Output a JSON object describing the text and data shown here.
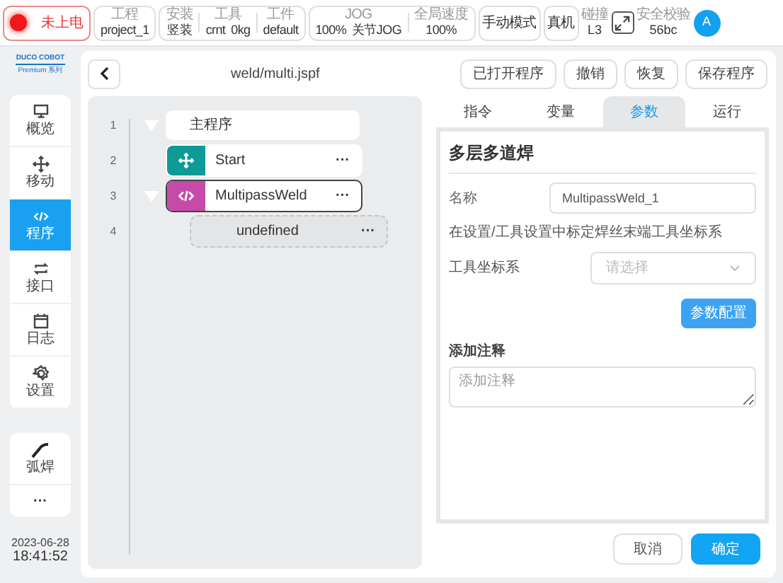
{
  "top_bar": [
    {
      "kind": "power",
      "label": "未上电",
      "on": false
    },
    {
      "kind": "group",
      "fields": [
        {
          "caption": "工程",
          "values": [
            "project_1"
          ]
        }
      ]
    },
    {
      "kind": "group",
      "fields": [
        {
          "caption": "安装",
          "values": [
            "竖装"
          ]
        },
        {
          "caption": "工具",
          "values": [
            "crnt",
            "0kg"
          ]
        },
        {
          "caption": "工件",
          "values": [
            "default"
          ]
        }
      ]
    },
    {
      "kind": "group",
      "fields": [
        {
          "caption": "JOG",
          "values": [
            "100%",
            "关节JOG"
          ]
        },
        {
          "caption": "全局速度",
          "values": [
            "100%"
          ]
        }
      ]
    },
    {
      "kind": "button",
      "label": "手动模式"
    },
    {
      "kind": "button",
      "label": "真机"
    },
    {
      "kind": "info",
      "caption": "碰撞",
      "value": "L3"
    },
    {
      "kind": "expand"
    },
    {
      "kind": "info",
      "caption": "安全校验",
      "value": "56bc"
    },
    {
      "kind": "avatar",
      "label": "A"
    }
  ],
  "logo": {
    "brand": "DUCO COBOT",
    "series": "Premium 系列"
  },
  "sidebar": {
    "items": [
      {
        "label": "概览",
        "selected": false
      },
      {
        "label": "移动",
        "selected": false
      },
      {
        "label": "程序",
        "selected": true
      },
      {
        "label": "接口",
        "selected": false
      },
      {
        "label": "日志",
        "selected": false
      },
      {
        "label": "设置",
        "selected": false
      }
    ],
    "extra": [
      {
        "kind": "tool",
        "label": "弧焊"
      },
      {
        "kind": "more",
        "label": "···"
      }
    ],
    "date": "2023-06-28",
    "time": "18:41:52"
  },
  "header": {
    "title": "weld/multi.jspf",
    "buttons": [
      "已打开程序",
      "撤销",
      "恢复",
      "保存程序"
    ]
  },
  "tree": [
    {
      "line": "1",
      "kind": "root",
      "label": "主程序",
      "expanded": true,
      "selected": false,
      "children": [
        {
          "line": "2",
          "kind": "command",
          "label": "Start",
          "menu": "···",
          "color": "#0e9a97",
          "selected": false
        },
        {
          "line": "3",
          "kind": "command",
          "label": "MultipassWeld",
          "menu": "···",
          "color": "#c64aa7",
          "selected": true,
          "expanded": true,
          "children": [
            {
              "line": "4",
              "kind": "placeholder",
              "label": "undefined",
              "menu": "···",
              "selected": false
            }
          ]
        }
      ]
    }
  ],
  "tabs": [
    {
      "label": "指令",
      "selected": false
    },
    {
      "label": "变量",
      "selected": false
    },
    {
      "label": "参数",
      "selected": true
    },
    {
      "label": "运行",
      "selected": false
    }
  ],
  "params": {
    "title": "多层多道焊",
    "name_label": "名称",
    "name_value": "MultipassWeld_1",
    "hint": "在设置/工具设置中标定焊丝末端工具坐标系",
    "tool_label": "工具坐标系",
    "tool_placeholder": "请选择",
    "config_button": "参数配置",
    "comment_label": "添加注释",
    "comment_placeholder": "添加注释"
  },
  "footer": {
    "buttons": [
      {
        "label": "取消",
        "kind": "secondary"
      },
      {
        "label": "确定",
        "kind": "primary"
      }
    ]
  }
}
